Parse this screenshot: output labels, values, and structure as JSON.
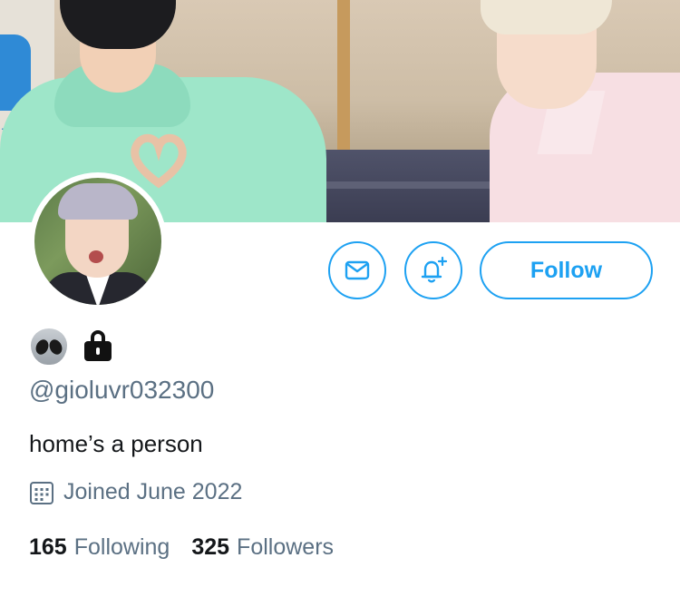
{
  "profile": {
    "handle": "@gioluvr032300",
    "bio": "home’s a person",
    "joined": "Joined June 2022",
    "name_emojis": [
      "alien-emoji",
      "lock-emoji"
    ]
  },
  "actions": {
    "message_icon": "envelope-icon",
    "notify_icon": "bell-plus-icon",
    "follow_label": "Follow"
  },
  "stats": {
    "following_count": "165",
    "following_label": "Following",
    "followers_count": "325",
    "followers_label": "Followers"
  },
  "colors": {
    "accent": "#1da1f2",
    "secondary_text": "#5b7083",
    "primary_text": "#14171a"
  }
}
